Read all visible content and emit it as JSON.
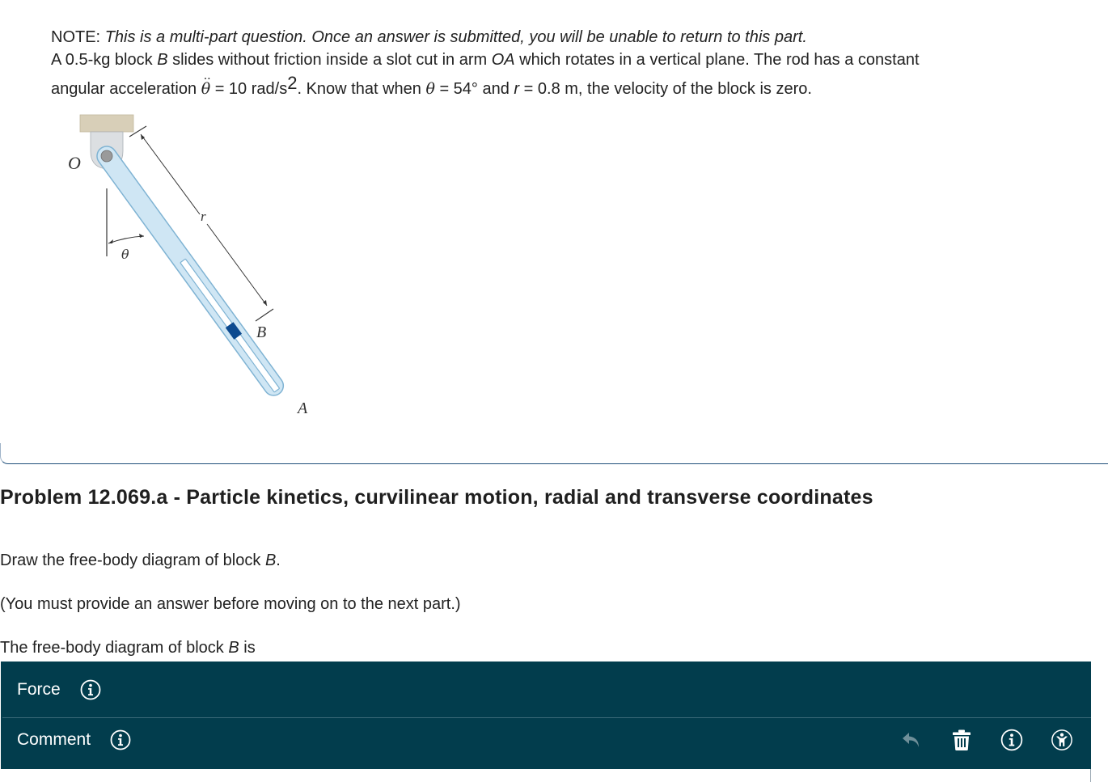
{
  "intro": {
    "note_label": "NOTE:",
    "note_text": "This is a multi-part question. Once an answer is submitted, you will be unable to return to this part.",
    "line2_a": "A 0.5-kg block ",
    "line2_b": "B",
    "line2_c": " slides without friction inside a slot cut in arm ",
    "line2_d": "OA",
    "line2_e": " which rotates in a vertical plane. The rod has a constant",
    "line3_a": "angular acceleration ",
    "theta_symbol": "θ",
    "line3_b": " = 10 rad/s",
    "line3_sup": "2",
    "line3_c": ". Know that when ",
    "line3_d": " = 54° and ",
    "r_symbol": "r",
    "line3_e": " = 0.8 m, the velocity of the block is zero."
  },
  "figure": {
    "label_O": "O",
    "label_r": "r",
    "label_theta": "θ",
    "label_B": "B",
    "label_A": "A",
    "colors": {
      "arm_fill": "#cfe6f4",
      "arm_stroke": "#7fb3d3",
      "block": "#0d4a8f",
      "support": "#d8cfb8",
      "bracket": "#d9dde0",
      "pin": "#9a9a9a"
    }
  },
  "problem": {
    "title": "Problem 12.069.a - Particle kinetics, curvilinear motion, radial and transverse coordinates",
    "instruction_a": "Draw the free-body diagram of block ",
    "instruction_b": "B",
    "instruction_c": ".",
    "must_answer": "(You must provide an answer before moving on to the next part.)",
    "prompt_a": "The free-body diagram of block ",
    "prompt_b": "B",
    "prompt_c": " is"
  },
  "fbd_panel": {
    "background": "#023d4d",
    "rows": [
      {
        "label": "Force",
        "icon": "info-icon"
      },
      {
        "label": "Comment",
        "icon": "info-icon"
      }
    ],
    "tools": [
      {
        "name": "undo",
        "icon": "undo-arrow-icon",
        "enabled": false
      },
      {
        "name": "delete",
        "icon": "trash-icon",
        "enabled": true
      },
      {
        "name": "info",
        "icon": "info-icon",
        "enabled": true
      },
      {
        "name": "accessibility",
        "icon": "accessibility-icon",
        "enabled": true
      }
    ]
  }
}
